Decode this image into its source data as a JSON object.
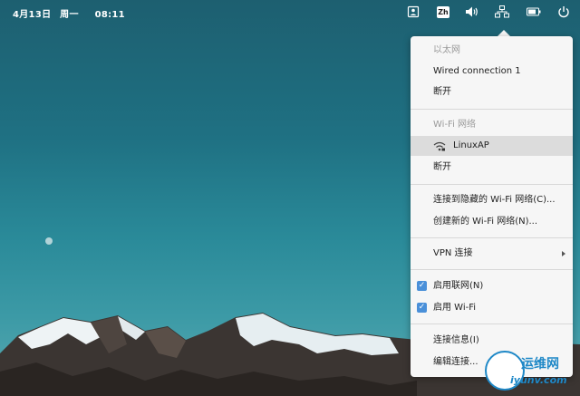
{
  "topbar": {
    "date": "4月13日",
    "weekday": "周一",
    "time": "08:11",
    "lang_label": "Zh",
    "icons": [
      "user-icon",
      "lang-icon",
      "volume-icon",
      "network-icon",
      "battery-icon",
      "power-icon"
    ]
  },
  "menu": {
    "ethernet_header": "以太网",
    "wired_connection": "Wired connection 1",
    "ethernet_disconnect": "断开",
    "wifi_header": "Wi-Fi 网络",
    "wifi_network": "LinuxAP",
    "wifi_disconnect": "断开",
    "connect_hidden": "连接到隐藏的 Wi-Fi 网络(C)...",
    "create_new": "创建新的 Wi-Fi 网络(N)...",
    "vpn": "VPN 连接",
    "enable_networking": "启用联网(N)",
    "enable_wifi": "启用 Wi-Fi",
    "connection_info": "连接信息(I)",
    "edit_connections": "编辑连接..."
  },
  "watermark": {
    "text": "运维网",
    "sub": "iyunv.com"
  },
  "colors": {
    "accent": "#4a90d9",
    "menu_bg": "#f6f6f6",
    "sky_top": "#1d5f70"
  }
}
